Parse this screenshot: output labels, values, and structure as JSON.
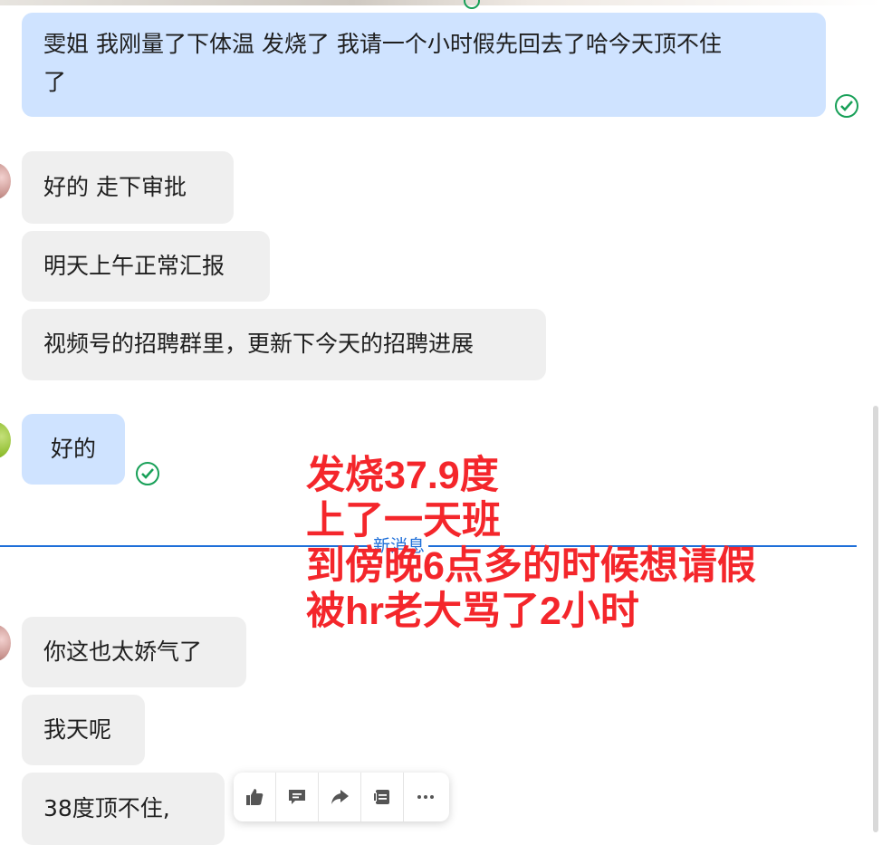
{
  "messages": {
    "m1": "雯姐 我刚量了下体温 发烧了 我请一个小时假先回去了哈今天顶不住了",
    "m1_line1": "雯姐 我刚量了下体温 发烧了 我请一个小时假先回去了哈今天顶不住",
    "m1_line2": "了",
    "m2": "好的  走下审批",
    "m3": "明天上午正常汇报",
    "m4": "视频号的招聘群里，更新下今天的招聘进展",
    "m5": "好的",
    "m6": "你这也太娇气了",
    "m7": "我天呢",
    "m8": "38度顶不住,"
  },
  "divider": {
    "label": "新消息"
  },
  "overlay": {
    "line1": "发烧37.9度",
    "line2": "上了一天班",
    "line3": "到傍晚6点多的时候想请假",
    "line4": "被hr老大骂了2小时"
  },
  "actions": [
    {
      "icon": "thumbs-up-icon"
    },
    {
      "icon": "comment-icon"
    },
    {
      "icon": "forward-icon"
    },
    {
      "icon": "quote-icon"
    },
    {
      "icon": "more-icon"
    }
  ],
  "colors": {
    "outgoing_bubble": "#cfe3ff",
    "incoming_bubble": "#efefef",
    "read_check": "#18a058",
    "divider": "#1e6fd9",
    "overlay_text": "#f4262b"
  }
}
